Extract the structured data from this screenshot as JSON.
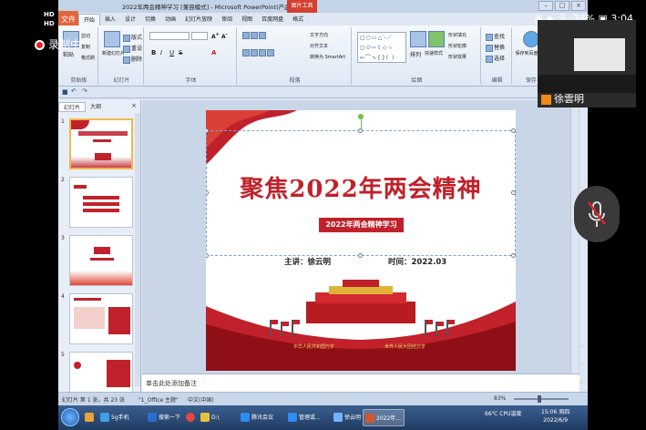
{
  "window": {
    "title": "2022年两会精神学习 [兼容模式] - Microsoft PowerPoint(产品激活失败)",
    "picture_tools": "图片工具",
    "app_button": "文件"
  },
  "tabs": [
    "开始",
    "插入",
    "设计",
    "切换",
    "动画",
    "幻灯片放映",
    "审阅",
    "视图",
    "百度网盘",
    "格式"
  ],
  "ribbon": {
    "clipboard": {
      "paste": "粘贴",
      "cut": "剪切",
      "copy": "复制",
      "format_painter": "格式刷",
      "label": "剪贴板"
    },
    "slides": {
      "new_slide": "新建幻灯片",
      "layout": "版式",
      "reset": "重设",
      "delete": "删除",
      "label": "幻灯片"
    },
    "font": {
      "label": "字体"
    },
    "paragraph": {
      "text_direction": "文字方向",
      "align_text": "对齐文本",
      "smartart": "转换为 SmartArt",
      "label": "段落"
    },
    "drawing": {
      "arrange": "排列",
      "quick_styles": "快速样式",
      "shape_fill": "形状填充",
      "shape_outline": "形状轮廓",
      "shape_effects": "形状效果",
      "label": "绘图"
    },
    "editing": {
      "find": "查找",
      "replace": "替换",
      "select": "选择",
      "label": "编辑"
    },
    "save": {
      "save_to_cloud": "保存到百度网盘",
      "label": "保存"
    }
  },
  "pane": {
    "tab_slides": "幻灯片",
    "tab_outline": "大纲",
    "close": "×",
    "slide_numbers": [
      "1",
      "2",
      "3",
      "4",
      "5"
    ]
  },
  "slide": {
    "title": "聚焦2022年两会精神",
    "subtitle": "2022年两会精神学习",
    "host": "主讲：徐云明",
    "time": "时间：2022.03",
    "banner_left": "中华人民共和国万岁",
    "banner_right": "世界人民大团结万岁"
  },
  "notes": {
    "placeholder": "单击此处添加备注"
  },
  "statusbar": {
    "slide_info": "幻灯片 第 1 张，共 23 张",
    "theme": "\"1_Office 主题\"",
    "language": "中文(中国)",
    "zoom": "83%"
  },
  "taskbar": {
    "items": [
      "5g手机",
      "搜索一下",
      "D:\\",
      "腾讯会议",
      "管理或...",
      "徐云明",
      "2022年..."
    ],
    "tray_temp": "66℃",
    "tray_cpu": "CPU温度",
    "clock_time": "15:06 周四",
    "clock_date": "2022/6/9"
  },
  "overlay": {
    "phone_status": "◉ ◈ 🎙 38% ▣ 3:04",
    "record_label": "录制中",
    "hd_labels": [
      "HD",
      "HD"
    ],
    "camera_name": "徐雲明"
  },
  "colors": {
    "accent_red": "#c0212a",
    "ribbon_bg": "#dfe8f4",
    "taskbar": "#1f3b62"
  }
}
